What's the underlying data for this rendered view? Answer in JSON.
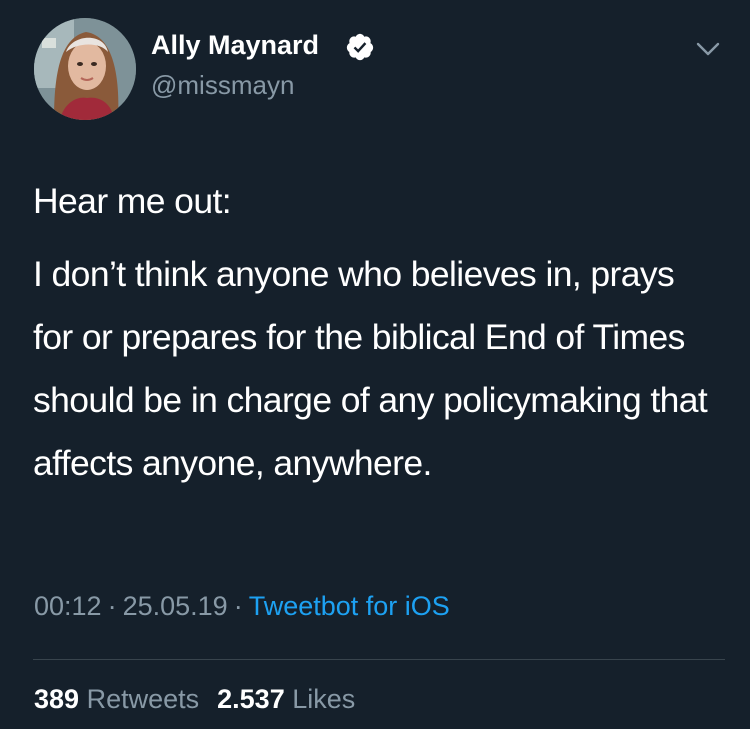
{
  "author": {
    "display_name": "Ally Maynard",
    "handle": "@missmayn",
    "verified": true
  },
  "tweet": {
    "intro": "Hear me out:",
    "body": "I don’t think anyone who believes in, prays for or prepares for the biblical End of Times should be in charge of any policymaking that affects anyone, anywhere.",
    "time": "00:12",
    "date": "25.05.19",
    "source": "Tweetbot for iOS",
    "separator": "·"
  },
  "stats": {
    "retweets_count": "389",
    "retweets_label": "Retweets",
    "likes_count": "2.537",
    "likes_label": "Likes"
  },
  "colors": {
    "background": "#15202b",
    "secondary_text": "#8899a6",
    "link": "#1da1f2",
    "divider": "#38444d"
  },
  "icons": {
    "verified": "verified-badge-icon",
    "chevron": "chevron-down-icon"
  }
}
